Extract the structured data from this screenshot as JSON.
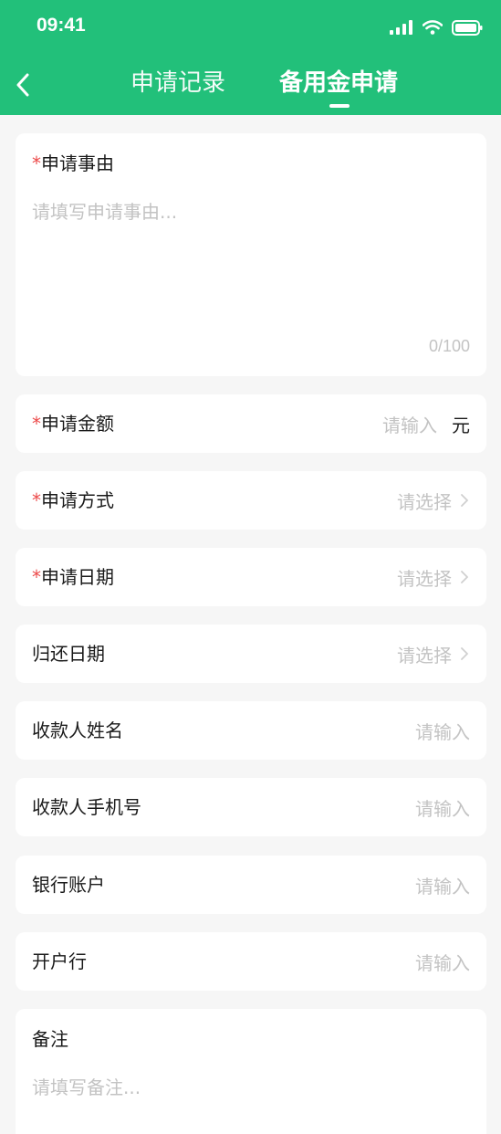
{
  "status": {
    "time": "09:41"
  },
  "nav": {
    "tabs": [
      {
        "label": "申请记录"
      },
      {
        "label": "备用金申请"
      }
    ]
  },
  "form": {
    "reason": {
      "label": "申请事由",
      "required_mark": "*",
      "placeholder": "请填写申请事由...",
      "counter": "0/100"
    },
    "amount": {
      "label": "申请金额",
      "required_mark": "*",
      "placeholder": "请输入",
      "unit": "元"
    },
    "method": {
      "label": "申请方式",
      "required_mark": "*",
      "placeholder": "请选择"
    },
    "apply_date": {
      "label": "申请日期",
      "required_mark": "*",
      "placeholder": "请选择"
    },
    "return_date": {
      "label": "归还日期",
      "placeholder": "请选择"
    },
    "payee_name": {
      "label": "收款人姓名",
      "placeholder": "请输入"
    },
    "payee_phone": {
      "label": "收款人手机号",
      "placeholder": "请输入"
    },
    "bank_account": {
      "label": "银行账户",
      "placeholder": "请输入"
    },
    "bank_branch": {
      "label": "开户行",
      "placeholder": "请输入"
    },
    "remark": {
      "label": "备注",
      "placeholder": "请填写备注..."
    }
  },
  "colors": {
    "accent": "#22c07a",
    "required": "#ec4a4a",
    "placeholder": "#c3c3c3"
  }
}
